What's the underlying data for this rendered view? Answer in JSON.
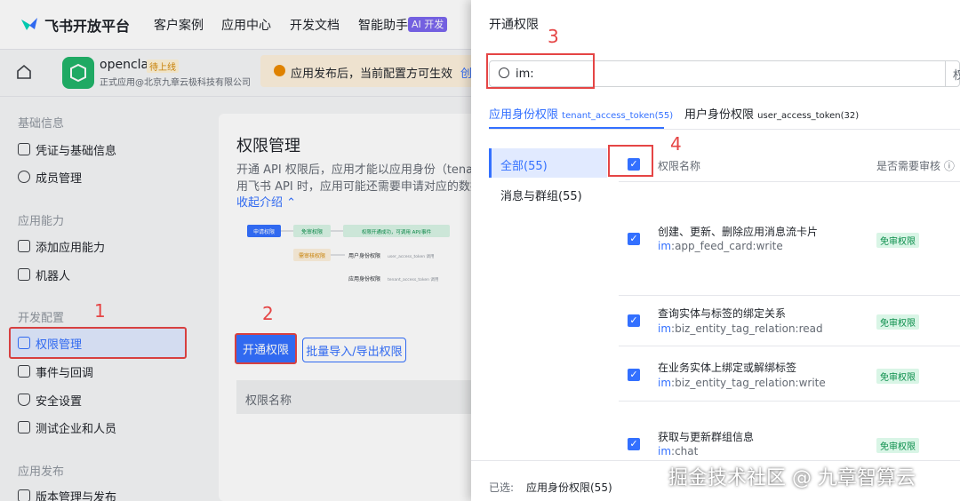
{
  "nav": {
    "brand": "飞书开放平台",
    "links": [
      "客户案例",
      "应用中心",
      "开发文档",
      "智能助手"
    ],
    "ai_badge": "AI 开发"
  },
  "app": {
    "name": "openclaw",
    "status": "待上线",
    "subtitle": "正式应用@北京九章云极科技有限公司",
    "notice": "应用发布后，当前配置方可生效",
    "notice_link": "创"
  },
  "sidebar": {
    "sections": [
      "基础信息",
      "应用能力",
      "开发配置",
      "应用发布"
    ],
    "items": [
      "凭证与基础信息",
      "成员管理",
      "添加应用能力",
      "机器人",
      "权限管理",
      "事件与回调",
      "安全设置",
      "测试企业和人员",
      "版本管理与发布"
    ]
  },
  "main": {
    "title": "权限管理",
    "desc1": "开通 API 权限后，应用才能以应用身份（tenant_ac",
    "desc2": "用飞书 API 时，应用可能还需要申请对应的数据权限",
    "collapse": "收起介绍",
    "btn_open": "开通权限",
    "btn_import": "批量导入/导出权限",
    "table_head": "权限名称",
    "diagram": {
      "apply": "申请权限",
      "free": "免审权限",
      "ok": "权限开通成功，可调用 API/事件",
      "review": "需审核权限",
      "user": "用户身份权限",
      "user_tok": "user_access_token 调用",
      "app": "应用身份权限",
      "app_tok": "tenant_access_token 调用"
    }
  },
  "annot": {
    "a1": "1",
    "a2": "2",
    "a3": "3",
    "a4": "4"
  },
  "drawer": {
    "title": "开通权限",
    "search_value": "im:",
    "search_trail": "权",
    "tab1": "应用身份权限",
    "tab1_tok": "tenant_access_token(55)",
    "tab2": "用户身份权限",
    "tab2_tok": "user_access_token(32)",
    "cat_all": "全部(55)",
    "cat_msg": "消息与群组(55)",
    "col_name": "权限名称",
    "col_review": "是否需要审核",
    "rows": [
      {
        "title": "创建、更新、删除应用消息流卡片",
        "prefix": "im",
        "code": ":app_feed_card:write",
        "badge": "免审权限"
      },
      {
        "title": "查询实体与标签的绑定关系",
        "prefix": "im",
        "code": ":biz_entity_tag_relation:read",
        "badge": "免审权限"
      },
      {
        "title": "在业务实体上绑定或解绑标签",
        "prefix": "im",
        "code": ":biz_entity_tag_relation:write",
        "badge": "免审权限"
      },
      {
        "title": "获取与更新群组信息",
        "prefix": "im",
        "code": ":chat",
        "badge": "免审权限"
      }
    ],
    "footer_label": "已选:",
    "footer_value": "应用身份权限(55)"
  },
  "watermark": "掘金技术社区 @ 九章智算云"
}
